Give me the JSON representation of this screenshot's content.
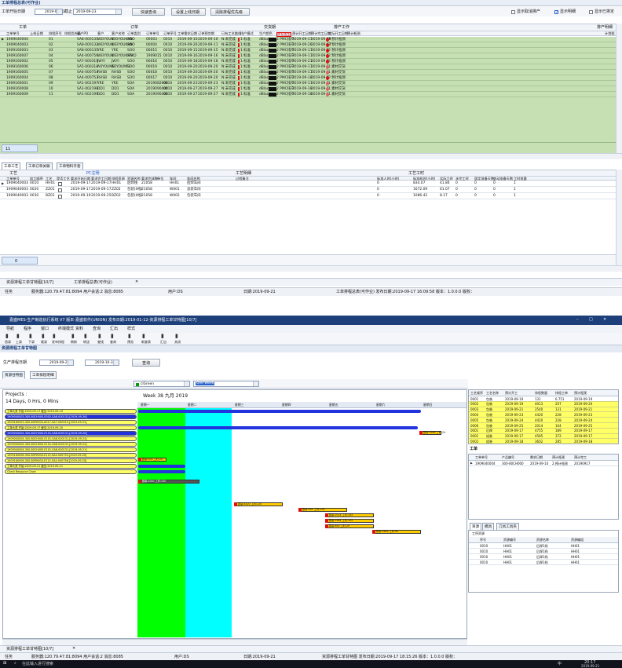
{
  "w1": {
    "menu_title": "工单排程总表(可作业)",
    "filter_label": "工单开始日期",
    "filter_from": "2019-09-21",
    "filter_to_label": "截止",
    "filter_to": "2019-09-23",
    "btn_query": "快速查询",
    "btn_set_date": "设置上线日期",
    "btn_clear_priority": "清除排程优先级",
    "chk_unsched": "显示取消排产",
    "chk_detail": "显示明细",
    "chk_done": "显示已排定",
    "group_headers": [
      "工单",
      "订单",
      "交货期",
      "排产工作",
      "排产明细"
    ],
    "col_headers": [
      "工单单号",
      "上线日期",
      "排程序号",
      "排程优先级",
      "客户PO",
      "客户",
      "客户名称",
      "订单类别",
      "订单单号",
      "订单序号",
      "工单需求日期",
      "订单预交期",
      "已有工艺路线",
      "排产模式",
      "生产颜色",
      "库存类型",
      "预计开工日期",
      "预计完工日期",
      "实际开工日期",
      "预计瓶颈",
      "计划批"
    ],
    "rows": [
      [
        "1909040004",
        "01",
        "SA8-000131",
        "WEIYOUK",
        "WEIYOUKAN",
        "SOO",
        "00003",
        "0010",
        "2019-09-10",
        "2019-09-10",
        "N:未完成",
        "1:标准",
        "dBlack",
        "2 PMC排产",
        "2019-09-17",
        "2019-09-19",
        "2:预计瓶颈"
      ],
      [
        "1909040003",
        "02",
        "SA8-000132",
        "WEIYOUK",
        "WEIYOUKAN",
        "SOO",
        "00004",
        "0010",
        "2019-09-26",
        "2019-09-11",
        "N:未完成",
        "1:标准",
        "dBlack",
        "2 PMC排产",
        "2019-09-26",
        "2019-09-17",
        "2:预计瓶颈"
      ],
      [
        "1909160003",
        "03",
        "SA8-000135",
        "YRE",
        "YRE",
        "SOO",
        "00015",
        "0010",
        "2019-09-15",
        "2019-09-15",
        "N:未完成",
        "1:标准",
        "dBlack",
        "2 PMC排产",
        "2019-09-17",
        "2019-09-1",
        "2:预计瓶颈"
      ],
      [
        "1909160007",
        "04",
        "SA4-000756",
        "WEIYOUK",
        "WEIYOUKAN",
        "STKO",
        "1909015",
        "0010",
        "2019-09-16",
        "2019-09-16",
        "N:未完成",
        "1:标准",
        "dBlack",
        "2 PMC排产",
        "2019-09-17",
        "2019-09-1",
        "2:预计瓶颈"
      ],
      [
        "1909160002",
        "05",
        "SA7-000319",
        "JWYI",
        "JWYI",
        "SOO",
        "00016",
        "0010",
        "2019-09-18",
        "2019-09-18",
        "N:未完成",
        "1:标准",
        "dBlack",
        "2 PMC排产",
        "2019-09-21",
        "2019-09-2",
        "2:预计瓶颈"
      ],
      [
        "1909160006",
        "06",
        "SA5-000318",
        "AOYOUME",
        "AOYOUMEI",
        "SOO",
        "00019",
        "0010",
        "2019-09-20",
        "2019-09-20",
        "N:未完成",
        "1:标准",
        "dBlack",
        "2 PMC排产",
        "2019-09-17",
        "2019-09-1",
        "1:素材交货"
      ],
      [
        "1909160005",
        "07",
        "SA4-000754",
        "RHSB",
        "RHSB",
        "SOO",
        "00018",
        "0010",
        "2019-09-20",
        "2019-09-20",
        "N:未完成",
        "1:标准",
        "dBlack",
        "2 PMC排产",
        "2019-09-17",
        "2019-09-1",
        "1:素材交货"
      ],
      [
        "1909160004",
        "08",
        "SA4-000753",
        "RHSB",
        "RHSB",
        "SOO",
        "00017",
        "0010",
        "2019-09-20",
        "2019-09-20",
        "N:未完成",
        "1:标准",
        "dBlack",
        "2 PMC排产",
        "2019-09-18",
        "2019-09-2",
        "2:预计瓶颈"
      ],
      [
        "1909160001",
        "09",
        "SA1-002197",
        "YRE",
        "YRE",
        "SOA",
        "2019082600",
        "0010",
        "2019-09-23",
        "2019-09-23",
        "N:未完成",
        "1:标准",
        "dBlack",
        "2 PMC排产",
        "2019-09-17",
        "2019-09-1",
        "1:素材交货"
      ],
      [
        "1909160008",
        "10",
        "SA1-002198",
        "DD1",
        "DD1",
        "SOA",
        "2019090400",
        "0010",
        "2019-09-27",
        "2019-09-27",
        "N:未完成",
        "1:标准",
        "dBlack",
        "2 PMC排产",
        "2019-09-18",
        "2019-09-2",
        "1:素材交货"
      ],
      [
        "1909160009",
        "11",
        "SA1-002199",
        "DD1",
        "DD1",
        "SOA",
        "2019090400",
        "0010",
        "2019-09-27",
        "2019-09-27",
        "N:未完成",
        "1:标准",
        "dBlack",
        "2 PMC排产",
        "2019-09-18",
        "2019-09-1",
        "1:素材交货"
      ]
    ],
    "footer_count": "11",
    "tabs": [
      "工单工艺",
      "工单订单关联",
      "工单物料齐套"
    ],
    "proc_groups": [
      "工艺",
      "PC注明",
      "工艺明细",
      "工艺工时"
    ],
    "proc_headers": [
      "工单单号",
      "加工顺序",
      "工艺",
      "是否工艺",
      "要求开始日期",
      "要求完工日期",
      "排程资源",
      "资源名称",
      "要求完成数",
      "单位",
      "车间",
      "车间名称",
      "过程备注",
      "标准人时(小时)",
      "标准机时(小时)",
      "实际工时",
      "未完工时",
      "固定准备天数",
      "变动准备天数",
      "工时批量"
    ],
    "proc_rows": [
      [
        "1909040003",
        "0010",
        "HH01",
        "2019-09-17",
        "2019-09-17",
        "HH01",
        "后焊线",
        "21058",
        "HH01",
        "后焊车间",
        "0",
        "834.07",
        "41.84",
        "0",
        "0",
        "0",
        "1"
      ],
      [
        "1909040003",
        "0020",
        "ZZ01",
        "2019-09-17",
        "2019-09-17",
        "ZZ02",
        "包装(II线)",
        "21058",
        "W001",
        "总装车间",
        "0",
        "1672.09",
        "61.07",
        "0",
        "0",
        "0",
        "1"
      ],
      [
        "1909040003",
        "0030",
        "BZ01",
        "2019-09-19",
        "2019-09-25",
        "BZ02",
        "包装(II线)",
        "21058",
        "W002",
        "包装车间",
        "0",
        "1086.42",
        "8.17",
        "0",
        "0",
        "0",
        "1"
      ]
    ],
    "proc_count": "0",
    "bottom_tabs": [
      "资源排程工单甘特图[10/7]",
      "工单排程总表(可作业)"
    ],
    "status": [
      "任务",
      "服务器:120.79.47.81:8094 用户会话:2 消息:8085",
      "用户:DS",
      "日期:2019-09-21",
      "工单排程总表(可作业) 发布日期:2019-09-17 16:09:58 版本：1.0.0.0 版权："
    ]
  },
  "w2": {
    "title": "嘉盛MES-生产制造执行系统 V7 版本-嘉盛软件(URION) 发布日期:2019-01-12-资源排程工单甘特图[10/7]",
    "menus": [
      "导航",
      "程序",
      "窗口",
      "终端模式",
      "资料",
      "查询",
      "汇出",
      "样式"
    ],
    "toolbar": [
      "首录",
      "上录",
      "下录",
      "尾录",
      "发布排程",
      "刷新",
      "转送",
      "查找",
      "查询",
      "预览",
      "新查表",
      "汇出",
      "关闭"
    ],
    "section_title": "资源排程工单甘特图",
    "filter_label": "生产排程日期",
    "filter_from": "2019-09-21",
    "filter_to": "2019-10-31",
    "btn_query": "查询",
    "tabs": [
      "资源甘特图",
      "工单排程明细"
    ],
    "color_name": "clGreen",
    "range_name": "One Week",
    "projects_label": "Projects :",
    "duration": "14 Days, 0 Hrs, 0 Mins",
    "week_title": "Week 38 九月 2019",
    "day_labels": [
      "星期一",
      "星期二",
      "星期三",
      "星期四",
      "星期五",
      "星期六",
      "星期日"
    ],
    "tree_items": [
      "工单大类 开始:2019-09-17 截至:2019-09-19",
      "1909040003-300-80CH000-E002-SA8-000132-[2019-09-26]",
      "1909160003-300-80PH000-A017-SA7-000319-[2019-09-21]",
      "工单大类 开始:2019-09-17 截至:2019-09-20",
      "1909040004-300-80CH000-E101-SA8-000131-[2019-09-26]",
      "1909040004-300-80CH000-E101-SA8-000131-[2019-09-24]",
      "1909040004-300-80CH000-E101-SA8-000131-[2019-09-24]",
      "1909040004-300-80CH000-E101-SA8-000131-[2019-09-21]",
      "1909160006-300-80PH000-E115-SA4-000753-[2019-09-20]",
      "1909160006-300-80PH000-E115-SA4-000756-[2019-09-20]",
      "工单大类 开始:2019-09-21 截至:2019-09-21",
      "Client Resource Chart"
    ],
    "bar_labels": [
      "数量:5269  工时:24",
      "数量:500  工时:20",
      "数量:2040  工时:130",
      "数量:4420  工时:220",
      "数量:H02  工时:230",
      "数量:2014  工时:104",
      "数量:1984  工时:104",
      "数量:850  工时:29",
      "数量:1845  工时:95"
    ],
    "side_headers": [
      "工艺顺序",
      "工艺名称",
      "预计开工",
      "排程数量",
      "排程工单",
      "预计瓶颈"
    ],
    "side_rows": [
      [
        "0001",
        "包装",
        "2019-09-19",
        "131",
        "6.751",
        "2019-09-19"
      ],
      [
        "0002",
        "包装",
        "2019-09-19",
        "4013",
        "207",
        "2019-09-20"
      ],
      [
        "0003",
        "包装",
        "2019-09-21",
        "2540",
        "131",
        "2019-09-21"
      ],
      [
        "0004",
        "包装",
        "2019-09-23",
        "4420",
        "228",
        "2019-09-23"
      ],
      [
        "0005",
        "包装",
        "2019-09-24",
        "4420",
        "228",
        "2019-09-24"
      ],
      [
        "0006",
        "包装",
        "2019-09-25",
        "2014",
        "104",
        "2019-09-25"
      ],
      [
        "0001",
        "后焊",
        "2019-09-17",
        "4755",
        "189",
        "2019-09-17"
      ],
      [
        "0001",
        "组装",
        "2019-09-17",
        "4585",
        "372",
        "2019-09-17"
      ],
      [
        "0002",
        "组装",
        "2019-09-18",
        "3602",
        "285",
        "2019-09-18"
      ]
    ],
    "wo_label": "工单",
    "wo_headers": [
      "工单单号",
      "产品编号",
      "需求日期",
      "预计瓶颈",
      "预计完工"
    ],
    "wo_row": [
      "1909040004",
      "300-80CH000",
      "2019-09-10",
      "2:预计瓶颈",
      "20190917"
    ],
    "res_tabs": [
      "资源",
      "模具",
      "刀具工具夹"
    ],
    "res_label": "工序资源",
    "res_headers": [
      "序号",
      "资源编号",
      "资源名称",
      "资源编组"
    ],
    "res_rows": [
      [
        "0010",
        "HH01",
        "后焊1线",
        "HH01"
      ],
      [
        "0010",
        "HH01",
        "后焊1线",
        "HH01"
      ],
      [
        "0010",
        "HH01",
        "后焊1线",
        "HH01"
      ],
      [
        "0010",
        "HH01",
        "后焊1线",
        "HH01"
      ]
    ],
    "bottom_tab": "资源排程工单甘特图[10/7]",
    "status": [
      "任务",
      "服务器:120.79.47.81:8094 用户会话:2 消息:8085",
      "用户:DS",
      "日期:2019-09-21",
      "资源排程工单甘特图 发布日期:2019-09-17 18:15:26 版本：1.0.0.0 版权："
    ]
  },
  "taskbar": {
    "search": "在此输入进行搜索",
    "time": "20:17",
    "date": "2019-09-21",
    "lang": "中"
  },
  "colors": {
    "grid_green": "#c6e0b4",
    "gantt_green": "#00ff00",
    "gantt_cyan": "#00ffff",
    "gantt_yellow": "#ffff66",
    "title_blue": "#1d3f7a",
    "taskbar": "#10131c"
  }
}
